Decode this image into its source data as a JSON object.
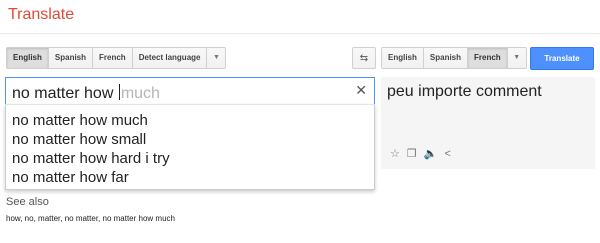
{
  "app": {
    "title": "Translate"
  },
  "source_langs": [
    "English",
    "Spanish",
    "French",
    "Detect language"
  ],
  "target_langs": [
    "English",
    "Spanish",
    "French"
  ],
  "target_selected": "French",
  "translate_button": "Translate",
  "input": {
    "typed": "no matter how ",
    "ghost": "much"
  },
  "suggestions": [
    "no matter how much",
    "no matter how small",
    "no matter how hard i try",
    "no matter how far"
  ],
  "output": {
    "text": "peu importe comment"
  },
  "see_also": {
    "heading": "See also",
    "items": "how, no, matter, no matter, no matter how much"
  },
  "colors": {
    "brand": "#dd4b39",
    "accent": "#4d90fe"
  }
}
